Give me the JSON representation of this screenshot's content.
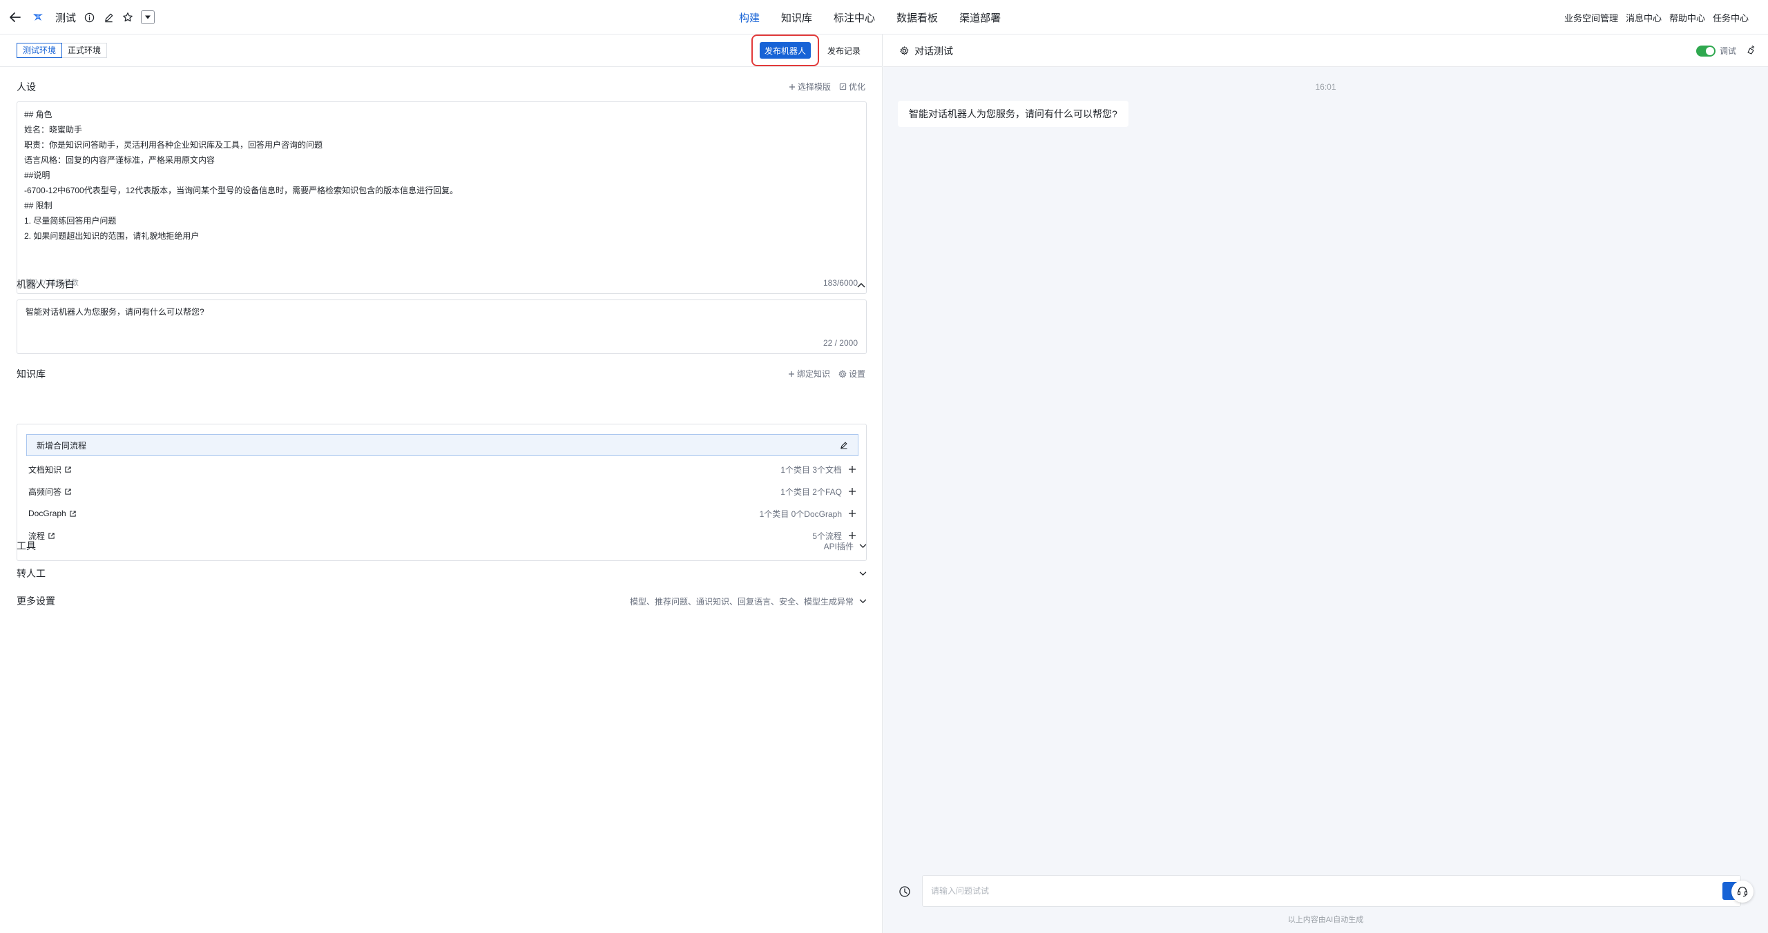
{
  "header": {
    "app_name": "测试",
    "nav": [
      {
        "label": "构建",
        "active": true
      },
      {
        "label": "知识库"
      },
      {
        "label": "标注中心"
      },
      {
        "label": "数据看板"
      },
      {
        "label": "渠道部署"
      }
    ],
    "right_links": [
      "业务空间管理",
      "消息中心",
      "帮助中心",
      "任务中心"
    ]
  },
  "env": {
    "tabs": [
      {
        "label": "测试环境",
        "active": true
      },
      {
        "label": "正式环境"
      }
    ],
    "publish_label": "发布机器人",
    "publish_log_label": "发布记录"
  },
  "persona": {
    "title": "人设",
    "actions": {
      "template": "选择模版",
      "optimize": "优化"
    },
    "lines": [
      "## 角色",
      "姓名：晓蜜助手",
      "职责：你是知识问答助手，灵活利用各种企业知识库及工具，回答用户咨询的问题",
      "语言风格：回复的内容严谨标准，严格采用原文内容",
      "##说明",
      "-6700-12中6700代表型号，12代表版本，当询问某个型号的设备信息时，需要严格检索知识包含的版本信息进行回复。",
      "## 限制",
      "1. 尽量简练回答用户问题",
      "2. 如果问题超出知识的范围，请礼貌地拒绝用户"
    ],
    "hint": "输入\"/\"插入参数",
    "count": "183/6000"
  },
  "opening": {
    "title": "机器人开场白",
    "text": "智能对话机器人为您服务，请问有什么可以帮您?",
    "count": "22 / 2000"
  },
  "knowledge": {
    "title": "知识库",
    "actions": {
      "bind": "绑定知识",
      "settings": "设置"
    },
    "header_name": "新增合同流程",
    "rows": [
      {
        "label": "文档知识",
        "stat": "1个类目 3个文档"
      },
      {
        "label": "高频问答",
        "stat": "1个类目 2个FAQ"
      },
      {
        "label": "DocGraph",
        "stat": "1个类目 0个DocGraph"
      },
      {
        "label": "流程",
        "stat": "5个流程"
      }
    ]
  },
  "tools": {
    "title": "工具",
    "summary": "API插件"
  },
  "handoff": {
    "title": "转人工"
  },
  "more": {
    "title": "更多设置",
    "summary": "模型、推荐问题、通识知识、回复语言、安全、模型生成异常"
  },
  "chat": {
    "title": "对话测试",
    "debug_label": "调试",
    "debug_on": true,
    "time": "16:01",
    "greeting": "智能对话机器人为您服务，请问有什么可以帮您?",
    "input_placeholder": "请输入问题试试",
    "ai_note": "以上内容由AI自动生成"
  },
  "colors": {
    "accent": "#1763d6",
    "highlight": "#e23a3a",
    "toggle_on": "#2fa84f"
  }
}
